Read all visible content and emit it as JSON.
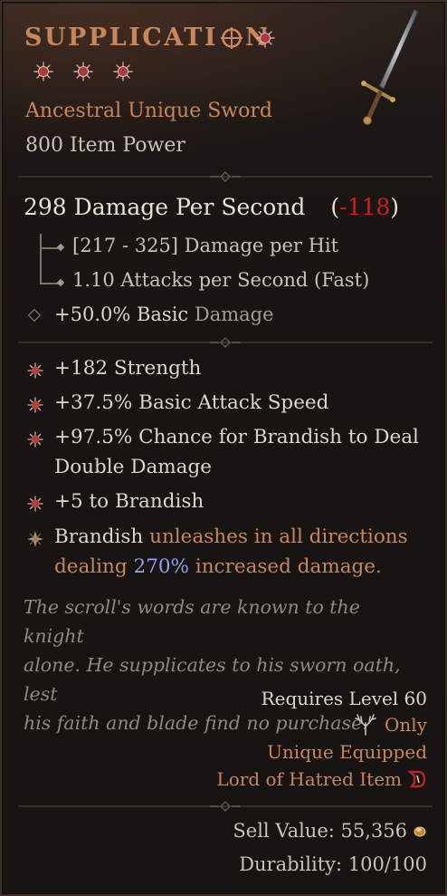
{
  "item": {
    "name_part1": "SUPPLICATI",
    "name_part2": "N",
    "rarity_line": "Ancestral Unique Sword",
    "item_power": "800 Item Power"
  },
  "damage": {
    "dps_text": "298 Damage Per Second",
    "delta_open": "(",
    "delta_value": "-118",
    "delta_close": ")",
    "per_hit": "[217 - 325] Damage per Hit",
    "attack_speed": "1.10 Attacks per Second (Fast)",
    "implicit_prefix": "+50.0% Basic ",
    "implicit_suffix": "Damage"
  },
  "affixes": [
    "+182 Strength",
    "+37.5% Basic Attack Speed",
    "+97.5% Chance for Brandish to Deal",
    "Double Damage",
    "+5 to Brandish"
  ],
  "unique_power": {
    "part1": "Brandish ",
    "part2": "unleashes in all directions",
    "part3": "dealing ",
    "part4": "270%",
    "part5": " increased damage."
  },
  "flavor": [
    "The scroll's words are known to the knight",
    "alone. He supplicates to his sworn oath, lest",
    "his faith and blade find no purchase."
  ],
  "requirements": {
    "level": "Requires Level 60",
    "class_only": "Only",
    "unique_equipped": "Unique Equipped",
    "expansion": "Lord of Hatred Item"
  },
  "footer": {
    "sell_value": "Sell Value: 55,356",
    "durability": "Durability: 100/100"
  },
  "colors": {
    "title": "#c7875a",
    "negative": "#c8201d",
    "highlight": "#9a9cf2",
    "affix_icon": "#c93a3a"
  },
  "icons": {
    "title_o": "compass-o-icon",
    "affix": "asterisk-burst-icon",
    "unique": "four-point-star-icon",
    "class": "druid-antler-icon",
    "expansion": "lord-of-hatred-icon",
    "gold": "gold-coin-icon"
  }
}
